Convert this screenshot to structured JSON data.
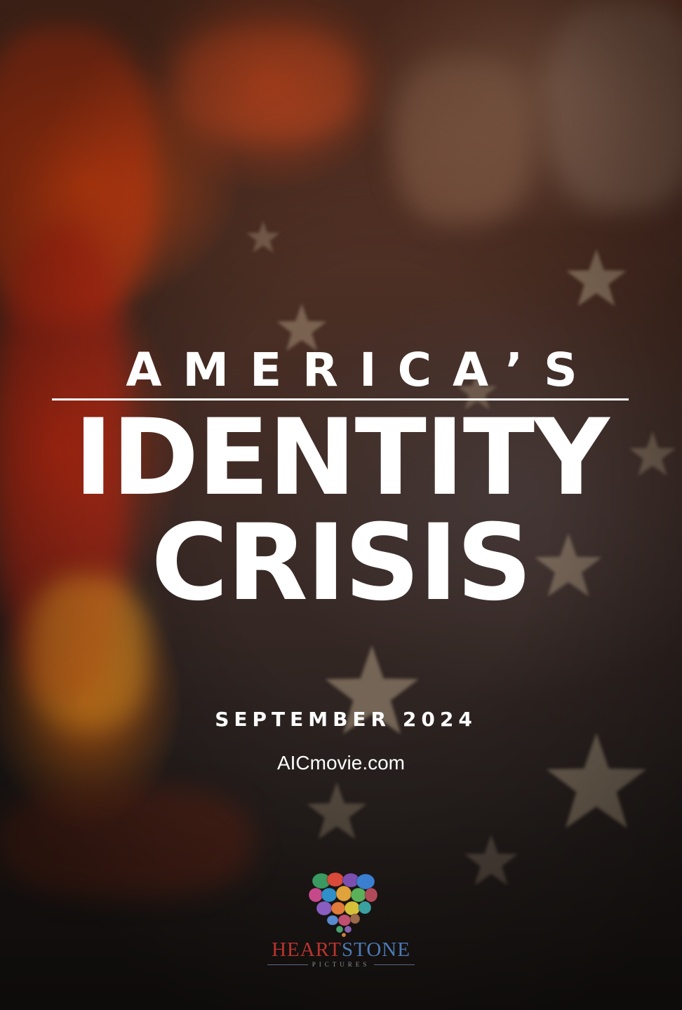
{
  "poster": {
    "title_top": "AMERICA’S",
    "title_line2": "IDENTITY",
    "title_line3": "CRISIS",
    "release_date": "SEPTEMBER 2024",
    "website": "AICmovie.com"
  },
  "studio": {
    "name_part1": "HEART",
    "name_part2": "STONE",
    "subtitle": "PICTURES",
    "logo_icon": "heart-of-colored-stones-icon"
  },
  "colors": {
    "title_text": "#ffffff",
    "brand_heart": "#b8342f",
    "brand_stone": "#4a7bb5"
  }
}
